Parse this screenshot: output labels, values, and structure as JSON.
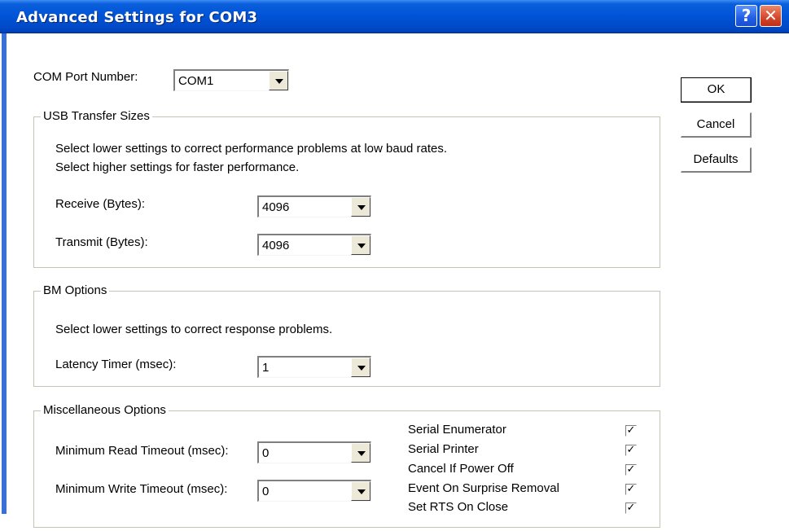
{
  "window": {
    "title": "Advanced Settings for COM3",
    "help_glyph": "?",
    "close_glyph": "✕"
  },
  "com_port": {
    "label": "COM Port Number:",
    "value": "COM1"
  },
  "buttons": {
    "ok": "OK",
    "cancel": "Cancel",
    "defaults": "Defaults"
  },
  "usb": {
    "legend": "USB Transfer Sizes",
    "desc1": "Select lower settings to correct performance problems at low baud rates.",
    "desc2": "Select higher settings for faster performance.",
    "receive_label": "Receive (Bytes):",
    "receive_value": "4096",
    "transmit_label": "Transmit (Bytes):",
    "transmit_value": "4096"
  },
  "bm": {
    "legend": "BM Options",
    "desc": "Select lower settings to correct response problems.",
    "latency_label": "Latency Timer (msec):",
    "latency_value": "1"
  },
  "misc": {
    "legend": "Miscellaneous Options",
    "read_label": "Minimum Read Timeout (msec):",
    "read_value": "0",
    "write_label": "Minimum Write Timeout (msec):",
    "write_value": "0",
    "checks": [
      {
        "label": "Serial Enumerator",
        "checked": true,
        "mark": "✓"
      },
      {
        "label": "Serial Printer",
        "checked": true,
        "mark": "✓"
      },
      {
        "label": "Cancel If Power Off",
        "checked": true,
        "mark": "✓"
      },
      {
        "label": "Event On Surprise Removal",
        "checked": true,
        "mark": "✓"
      },
      {
        "label": "Set RTS On Close",
        "checked": true,
        "mark": "✓"
      }
    ]
  }
}
